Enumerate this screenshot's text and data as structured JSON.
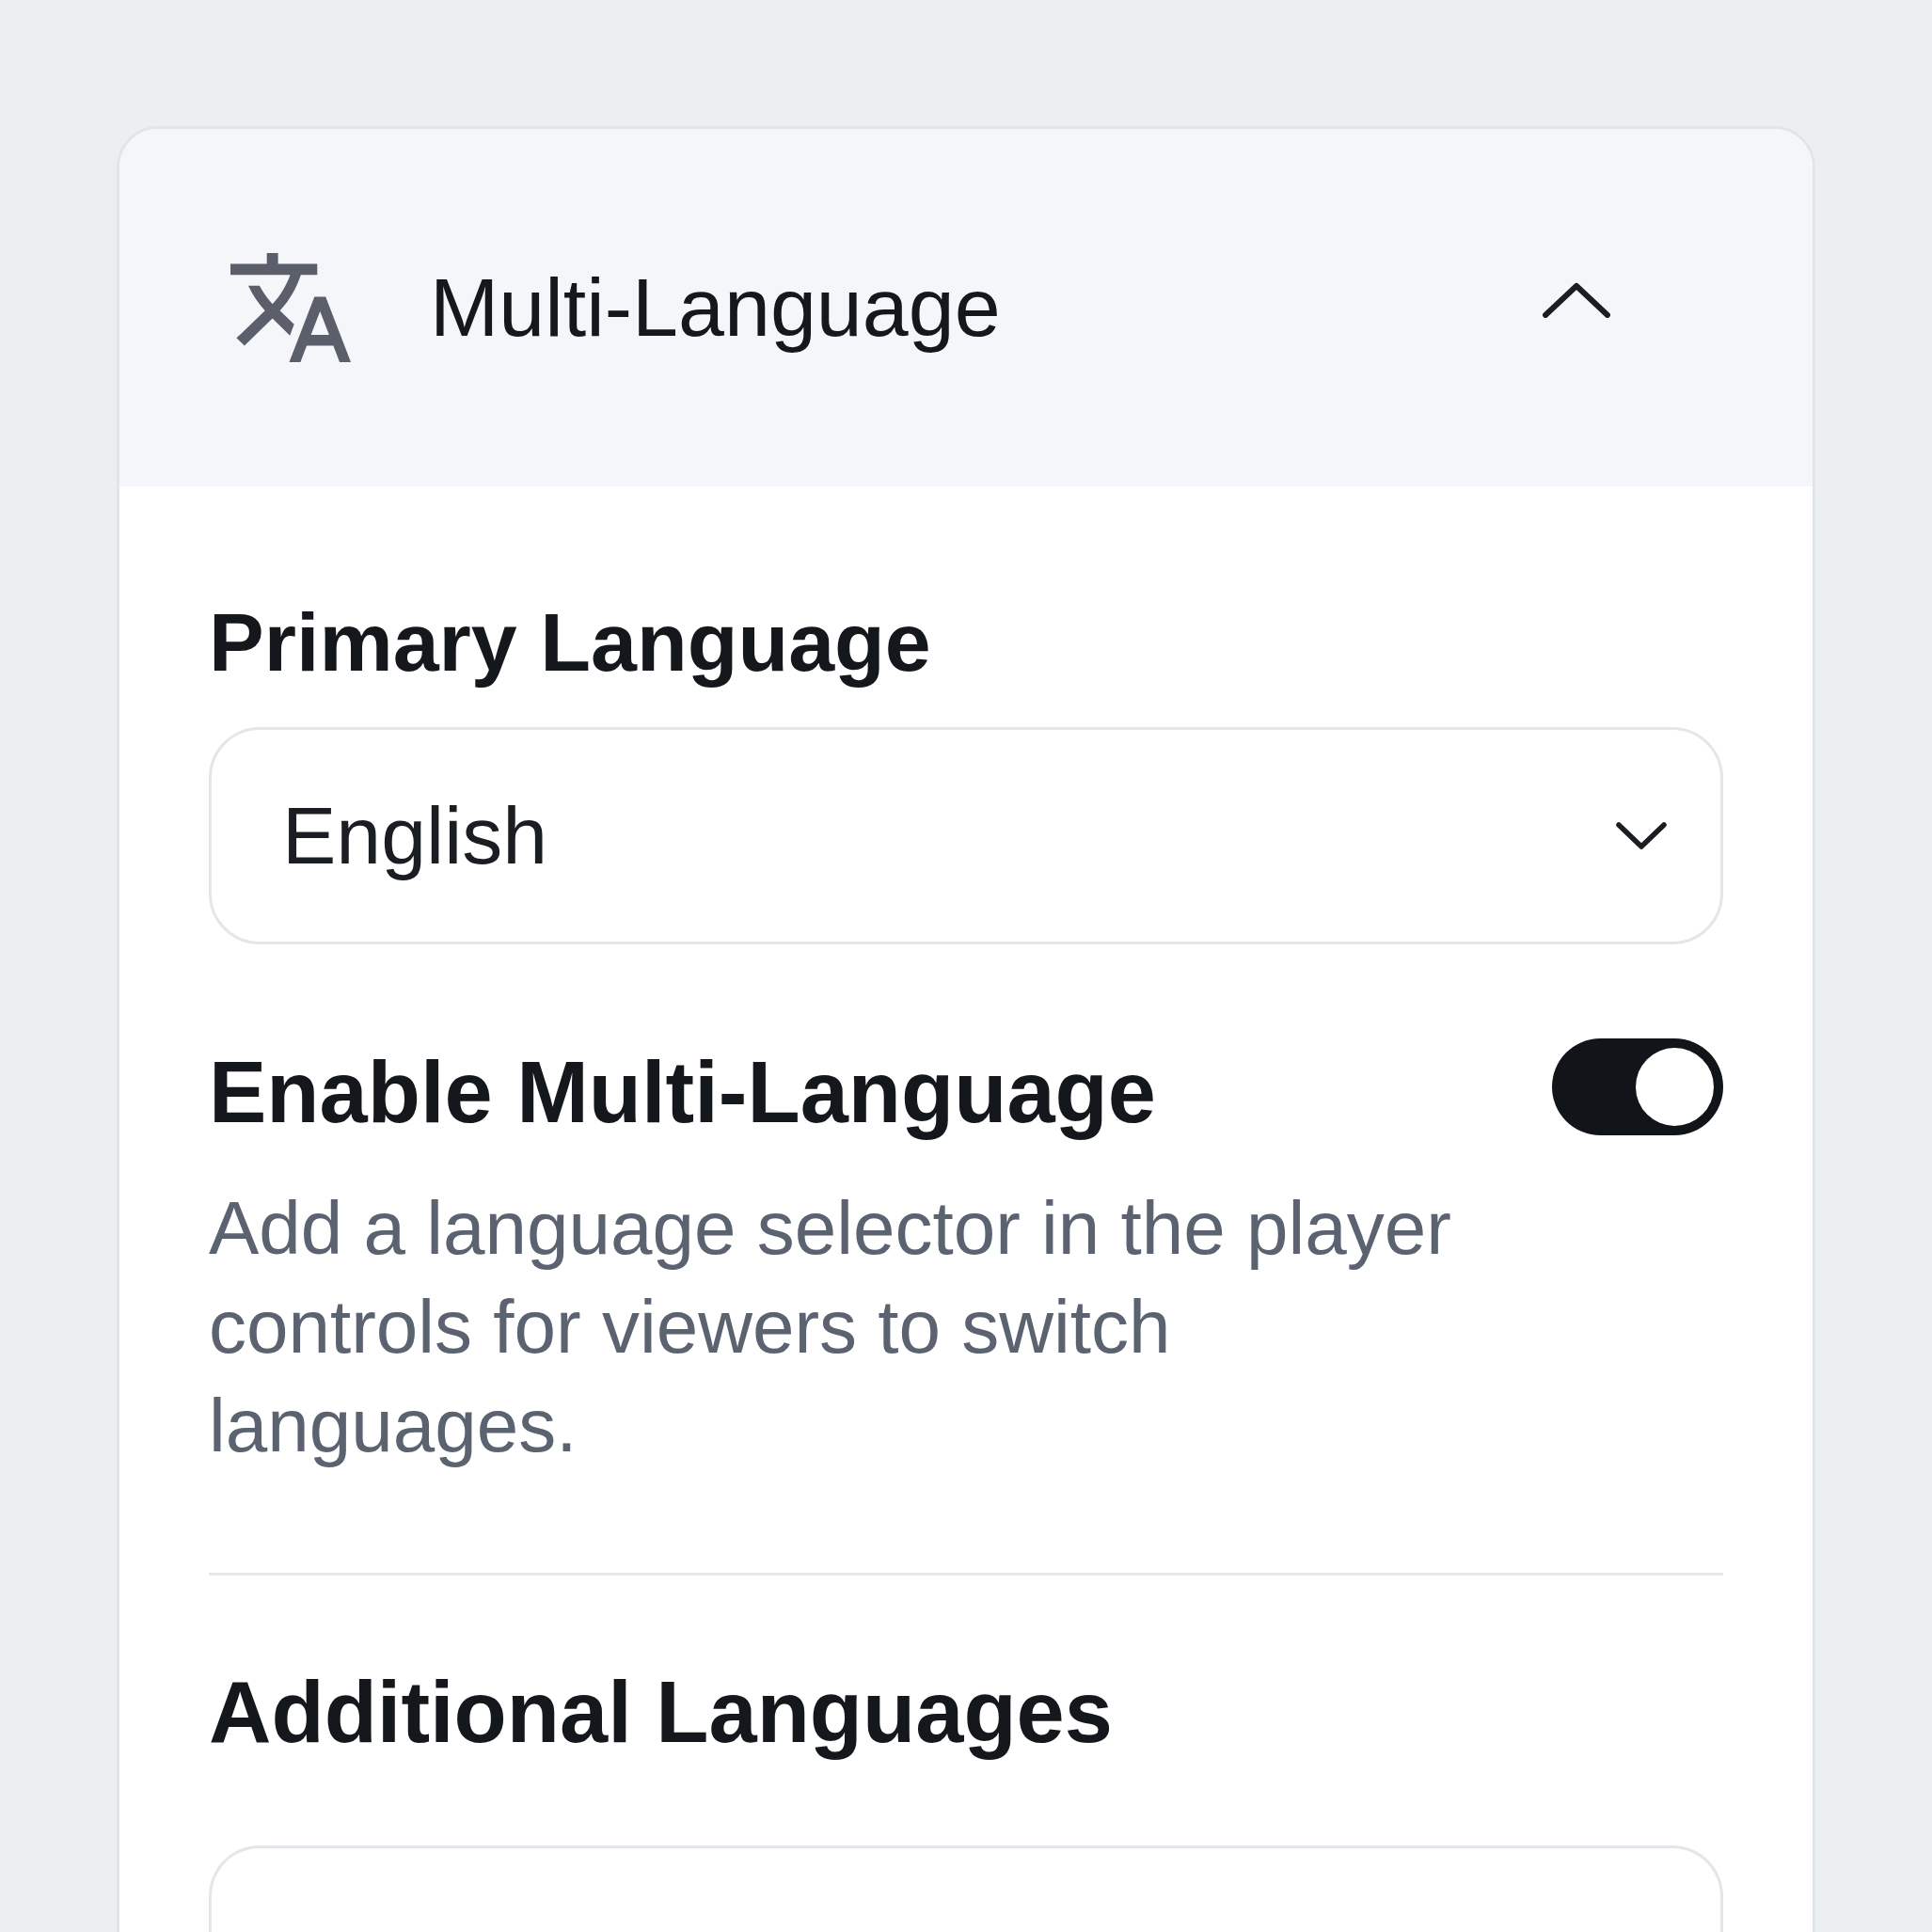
{
  "panel": {
    "title": "Multi-Language",
    "expanded": true
  },
  "primary_language": {
    "label": "Primary Language",
    "value": "English"
  },
  "multi_language_toggle": {
    "label": "Enable Multi-Language",
    "on": true,
    "description": "Add a language selector in the player controls for viewers to switch languages."
  },
  "additional_languages": {
    "label": "Additional Languages"
  }
}
